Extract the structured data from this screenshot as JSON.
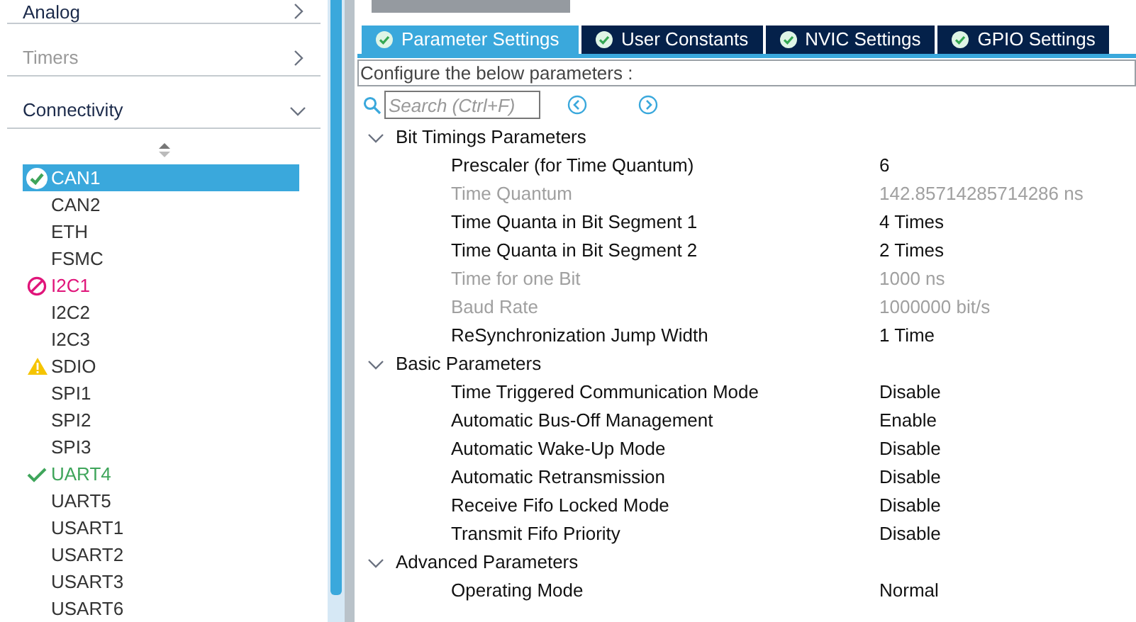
{
  "sidebar": {
    "categories": [
      {
        "label": "Analog",
        "expanded": false,
        "disabled": false
      },
      {
        "label": "Timers",
        "expanded": false,
        "disabled": true
      },
      {
        "label": "Connectivity",
        "expanded": true,
        "disabled": false
      }
    ],
    "items": [
      {
        "label": "CAN1",
        "kind": "ok",
        "selected": true
      },
      {
        "label": "CAN2",
        "kind": "none",
        "selected": false
      },
      {
        "label": "ETH",
        "kind": "none",
        "selected": false
      },
      {
        "label": "FSMC",
        "kind": "none",
        "selected": false
      },
      {
        "label": "I2C1",
        "kind": "error",
        "selected": false
      },
      {
        "label": "I2C2",
        "kind": "none",
        "selected": false
      },
      {
        "label": "I2C3",
        "kind": "none",
        "selected": false
      },
      {
        "label": "SDIO",
        "kind": "warning",
        "selected": false
      },
      {
        "label": "SPI1",
        "kind": "none",
        "selected": false
      },
      {
        "label": "SPI2",
        "kind": "none",
        "selected": false
      },
      {
        "label": "SPI3",
        "kind": "none",
        "selected": false
      },
      {
        "label": "UART4",
        "kind": "enabled",
        "selected": false
      },
      {
        "label": "UART5",
        "kind": "none",
        "selected": false
      },
      {
        "label": "USART1",
        "kind": "none",
        "selected": false
      },
      {
        "label": "USART2",
        "kind": "none",
        "selected": false
      },
      {
        "label": "USART3",
        "kind": "none",
        "selected": false
      },
      {
        "label": "USART6",
        "kind": "none",
        "selected": false
      }
    ]
  },
  "tabs": [
    {
      "label": "Parameter Settings",
      "selected": true
    },
    {
      "label": "User Constants",
      "selected": false
    },
    {
      "label": "NVIC Settings",
      "selected": false
    },
    {
      "label": "GPIO Settings",
      "selected": false
    }
  ],
  "instruction": "Configure the below parameters :",
  "search": {
    "placeholder": "Search (Ctrl+F)"
  },
  "groups": [
    {
      "title": "Bit Timings Parameters",
      "expanded": true,
      "params": [
        {
          "name": "Prescaler (for Time Quantum)",
          "value": "6",
          "disabled": false
        },
        {
          "name": "Time Quantum",
          "value": "142.85714285714286 ns",
          "disabled": true
        },
        {
          "name": "Time Quanta in Bit Segment 1",
          "value": "4 Times",
          "disabled": false
        },
        {
          "name": "Time Quanta in Bit Segment 2",
          "value": "2 Times",
          "disabled": false
        },
        {
          "name": "Time for one Bit",
          "value": "1000 ns",
          "disabled": true
        },
        {
          "name": "Baud Rate",
          "value": "1000000 bit/s",
          "disabled": true
        },
        {
          "name": "ReSynchronization Jump Width",
          "value": "1 Time",
          "disabled": false
        }
      ]
    },
    {
      "title": "Basic Parameters",
      "expanded": true,
      "params": [
        {
          "name": "Time Triggered Communication Mode",
          "value": "Disable",
          "disabled": false
        },
        {
          "name": "Automatic Bus-Off Management",
          "value": "Enable",
          "disabled": false
        },
        {
          "name": "Automatic Wake-Up Mode",
          "value": "Disable",
          "disabled": false
        },
        {
          "name": "Automatic Retransmission",
          "value": "Disable",
          "disabled": false
        },
        {
          "name": "Receive Fifo Locked Mode",
          "value": "Disable",
          "disabled": false
        },
        {
          "name": "Transmit Fifo Priority",
          "value": "Disable",
          "disabled": false
        }
      ]
    },
    {
      "title": "Advanced Parameters",
      "expanded": true,
      "params": [
        {
          "name": "Operating Mode",
          "value": "Normal",
          "disabled": false
        }
      ]
    }
  ]
}
